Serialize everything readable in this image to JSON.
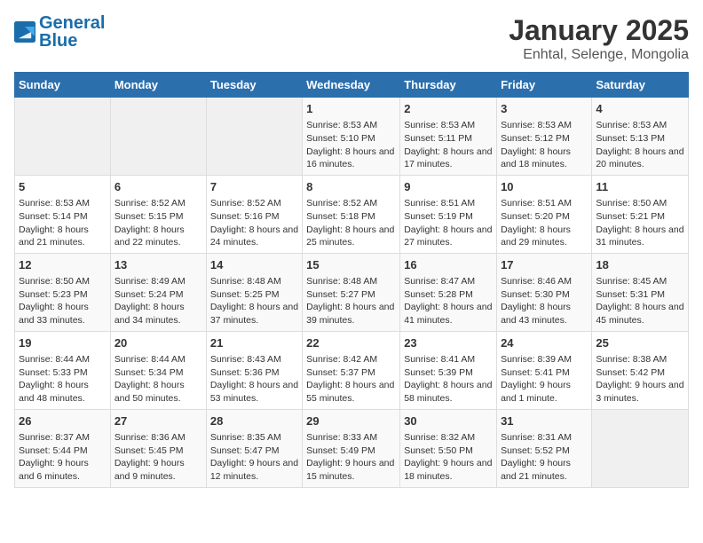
{
  "logo": {
    "text_general": "General",
    "text_blue": "Blue"
  },
  "title": "January 2025",
  "subtitle": "Enhtal, Selenge, Mongolia",
  "days_of_week": [
    "Sunday",
    "Monday",
    "Tuesday",
    "Wednesday",
    "Thursday",
    "Friday",
    "Saturday"
  ],
  "weeks": [
    [
      {
        "day": "",
        "info": ""
      },
      {
        "day": "",
        "info": ""
      },
      {
        "day": "",
        "info": ""
      },
      {
        "day": "1",
        "info": "Sunrise: 8:53 AM\nSunset: 5:10 PM\nDaylight: 8 hours and 16 minutes."
      },
      {
        "day": "2",
        "info": "Sunrise: 8:53 AM\nSunset: 5:11 PM\nDaylight: 8 hours and 17 minutes."
      },
      {
        "day": "3",
        "info": "Sunrise: 8:53 AM\nSunset: 5:12 PM\nDaylight: 8 hours and 18 minutes."
      },
      {
        "day": "4",
        "info": "Sunrise: 8:53 AM\nSunset: 5:13 PM\nDaylight: 8 hours and 20 minutes."
      }
    ],
    [
      {
        "day": "5",
        "info": "Sunrise: 8:53 AM\nSunset: 5:14 PM\nDaylight: 8 hours and 21 minutes."
      },
      {
        "day": "6",
        "info": "Sunrise: 8:52 AM\nSunset: 5:15 PM\nDaylight: 8 hours and 22 minutes."
      },
      {
        "day": "7",
        "info": "Sunrise: 8:52 AM\nSunset: 5:16 PM\nDaylight: 8 hours and 24 minutes."
      },
      {
        "day": "8",
        "info": "Sunrise: 8:52 AM\nSunset: 5:18 PM\nDaylight: 8 hours and 25 minutes."
      },
      {
        "day": "9",
        "info": "Sunrise: 8:51 AM\nSunset: 5:19 PM\nDaylight: 8 hours and 27 minutes."
      },
      {
        "day": "10",
        "info": "Sunrise: 8:51 AM\nSunset: 5:20 PM\nDaylight: 8 hours and 29 minutes."
      },
      {
        "day": "11",
        "info": "Sunrise: 8:50 AM\nSunset: 5:21 PM\nDaylight: 8 hours and 31 minutes."
      }
    ],
    [
      {
        "day": "12",
        "info": "Sunrise: 8:50 AM\nSunset: 5:23 PM\nDaylight: 8 hours and 33 minutes."
      },
      {
        "day": "13",
        "info": "Sunrise: 8:49 AM\nSunset: 5:24 PM\nDaylight: 8 hours and 34 minutes."
      },
      {
        "day": "14",
        "info": "Sunrise: 8:48 AM\nSunset: 5:25 PM\nDaylight: 8 hours and 37 minutes."
      },
      {
        "day": "15",
        "info": "Sunrise: 8:48 AM\nSunset: 5:27 PM\nDaylight: 8 hours and 39 minutes."
      },
      {
        "day": "16",
        "info": "Sunrise: 8:47 AM\nSunset: 5:28 PM\nDaylight: 8 hours and 41 minutes."
      },
      {
        "day": "17",
        "info": "Sunrise: 8:46 AM\nSunset: 5:30 PM\nDaylight: 8 hours and 43 minutes."
      },
      {
        "day": "18",
        "info": "Sunrise: 8:45 AM\nSunset: 5:31 PM\nDaylight: 8 hours and 45 minutes."
      }
    ],
    [
      {
        "day": "19",
        "info": "Sunrise: 8:44 AM\nSunset: 5:33 PM\nDaylight: 8 hours and 48 minutes."
      },
      {
        "day": "20",
        "info": "Sunrise: 8:44 AM\nSunset: 5:34 PM\nDaylight: 8 hours and 50 minutes."
      },
      {
        "day": "21",
        "info": "Sunrise: 8:43 AM\nSunset: 5:36 PM\nDaylight: 8 hours and 53 minutes."
      },
      {
        "day": "22",
        "info": "Sunrise: 8:42 AM\nSunset: 5:37 PM\nDaylight: 8 hours and 55 minutes."
      },
      {
        "day": "23",
        "info": "Sunrise: 8:41 AM\nSunset: 5:39 PM\nDaylight: 8 hours and 58 minutes."
      },
      {
        "day": "24",
        "info": "Sunrise: 8:39 AM\nSunset: 5:41 PM\nDaylight: 9 hours and 1 minute."
      },
      {
        "day": "25",
        "info": "Sunrise: 8:38 AM\nSunset: 5:42 PM\nDaylight: 9 hours and 3 minutes."
      }
    ],
    [
      {
        "day": "26",
        "info": "Sunrise: 8:37 AM\nSunset: 5:44 PM\nDaylight: 9 hours and 6 minutes."
      },
      {
        "day": "27",
        "info": "Sunrise: 8:36 AM\nSunset: 5:45 PM\nDaylight: 9 hours and 9 minutes."
      },
      {
        "day": "28",
        "info": "Sunrise: 8:35 AM\nSunset: 5:47 PM\nDaylight: 9 hours and 12 minutes."
      },
      {
        "day": "29",
        "info": "Sunrise: 8:33 AM\nSunset: 5:49 PM\nDaylight: 9 hours and 15 minutes."
      },
      {
        "day": "30",
        "info": "Sunrise: 8:32 AM\nSunset: 5:50 PM\nDaylight: 9 hours and 18 minutes."
      },
      {
        "day": "31",
        "info": "Sunrise: 8:31 AM\nSunset: 5:52 PM\nDaylight: 9 hours and 21 minutes."
      },
      {
        "day": "",
        "info": ""
      }
    ]
  ]
}
